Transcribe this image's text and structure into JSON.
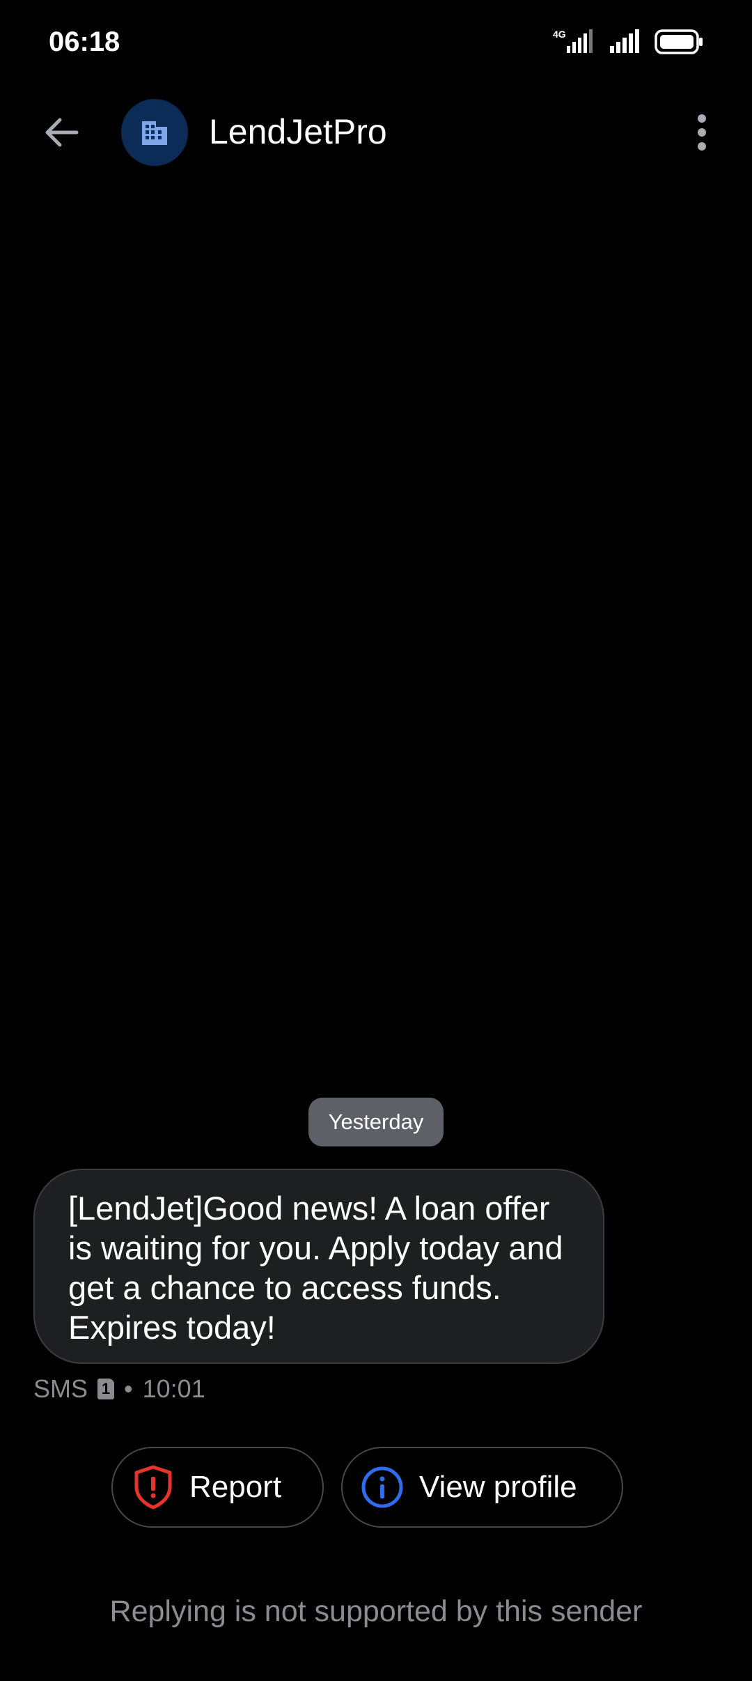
{
  "status_bar": {
    "time": "06:18",
    "network_label": "4G",
    "icons": [
      "4g-signal-icon",
      "signal-icon",
      "battery-icon"
    ]
  },
  "header": {
    "back_icon": "arrow-left-icon",
    "avatar_icon": "building-icon",
    "contact_name": "LendJetPro",
    "menu_icon": "more-vertical-icon"
  },
  "conversation": {
    "date_chip": "Yesterday",
    "message": {
      "text": "[LendJet]Good news! A loan offer is waiting for you. Apply today and get a chance to access funds. Expires today!",
      "channel": "SMS",
      "sim_slot": "1",
      "separator": "•",
      "time": "10:01"
    }
  },
  "actions": {
    "report_label": "Report",
    "view_profile_label": "View profile"
  },
  "footer": {
    "note": "Replying is not supported by this sender"
  },
  "colors": {
    "background": "#000000",
    "avatar_bg": "#0b2c57",
    "avatar_icon": "#7fa6e8",
    "bubble_bg": "#1e1f21",
    "chip_bg": "#5d6066",
    "report_accent": "#e5352b",
    "info_accent": "#2f6df0",
    "muted_text": "#8a8c90"
  }
}
